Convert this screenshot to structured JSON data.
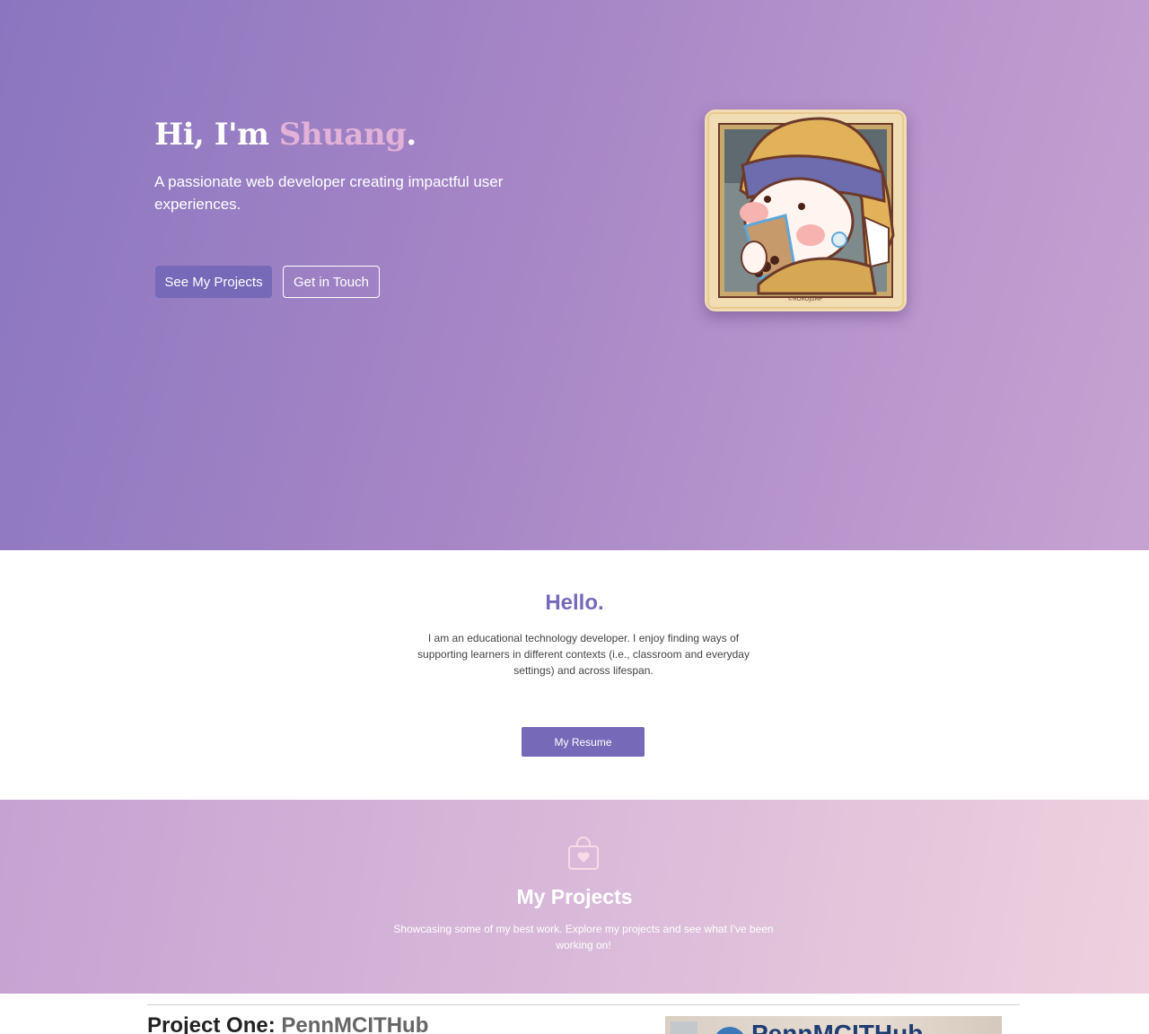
{
  "hero": {
    "greeting": "Hi, I'm ",
    "name": "Shuang",
    "period": ".",
    "subtitle": "A passionate web developer creating impactful user experiences.",
    "primary_button": "See My Projects",
    "secondary_button": "Get in Touch",
    "avatar_caption": "©ROROJUMP",
    "colors": {
      "accent": "#7669b8",
      "name_highlight": "#e3b2d8"
    }
  },
  "about": {
    "title": "Hello.",
    "text": "I am an educational technology developer. I enjoy finding ways of supporting learners in different contexts (i.e., classroom and everyday settings) and across lifespan.",
    "resume_button": "My Resume"
  },
  "projects": {
    "icon": "shopping-bag-heart-icon",
    "title": "My Projects",
    "subtitle": "Showcasing some of my best work. Explore my projects and see what I've been working on!",
    "items": [
      {
        "label": "Project One: ",
        "name": "PennMCITHub",
        "thumb_text": "PennMCITHub"
      }
    ]
  }
}
